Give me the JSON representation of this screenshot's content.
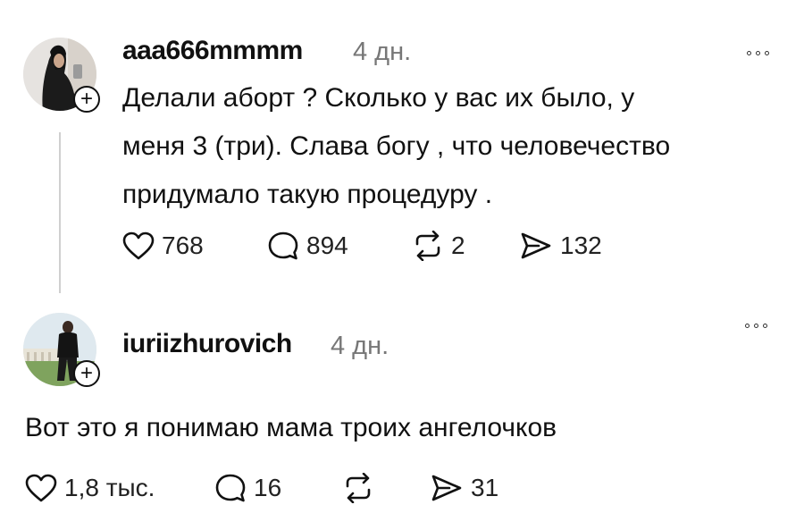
{
  "posts": [
    {
      "username": "aaa666mmmm",
      "time": "4 дн.",
      "text_lines": [
        "Делали аборт ? Сколько у вас их было, у",
        "меня 3 (три). Слава богу , что человечество",
        "придумало такую процедуру ."
      ],
      "likes": "768",
      "comments": "894",
      "reposts": "2",
      "shares": "132"
    },
    {
      "username": "iuriizhurovich",
      "time": "4 дн.",
      "text": "Вот это я понимаю мама троих ангелочков",
      "likes": "1,8 тыс.",
      "comments": "16",
      "shares": "31"
    }
  ],
  "icons": {
    "like": "heart-icon",
    "comment": "comment-icon",
    "repost": "repost-icon",
    "share": "share-icon",
    "more": "more-icon",
    "follow": "plus-icon"
  },
  "colors": {
    "text": "#111111",
    "muted": "#777777",
    "thread_line": "#cfcfcf"
  }
}
